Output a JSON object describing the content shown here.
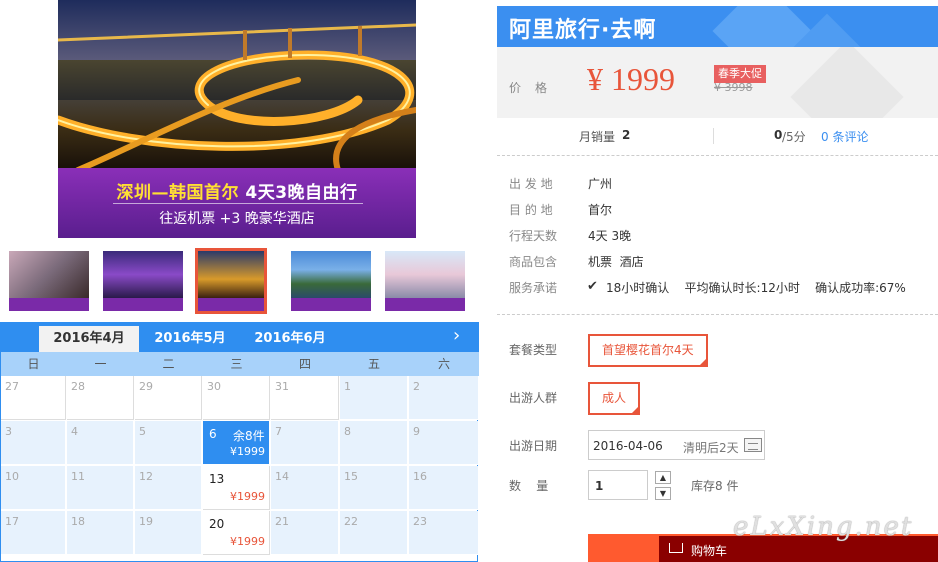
{
  "hero": {
    "title_a": "深圳—韩国首尔",
    "title_b": "4天3晚自由行",
    "subtitle": "往返机票 +3 晚豪华酒店"
  },
  "calendar": {
    "months": [
      "2016年4月",
      "2016年5月",
      "2016年6月"
    ],
    "active_month": 0,
    "next_icon": "chevron-right-icon",
    "weekdays": [
      "日",
      "一",
      "二",
      "三",
      "四",
      "五",
      "六"
    ],
    "rows": [
      [
        "27",
        "28",
        "29",
        "30",
        "31",
        "1",
        "2"
      ],
      [
        "3",
        "4",
        "5",
        "6",
        "7",
        "8",
        "9"
      ],
      [
        "10",
        "11",
        "12",
        "13",
        "14",
        "15",
        "16"
      ],
      [
        "17",
        "18",
        "19",
        "20",
        "21",
        "22",
        "23"
      ]
    ],
    "available": {
      "6": {
        "price": "¥1999",
        "stock": "余8件"
      },
      "13": {
        "price": "¥1999"
      },
      "20": {
        "price": "¥1999"
      }
    },
    "selected": "6"
  },
  "brand": {
    "title": "阿里旅行·去啊"
  },
  "price": {
    "label": "价格",
    "value": "¥ 1999",
    "promo": "春季大促",
    "original": "¥ 3998"
  },
  "sales": {
    "monthly_label": "月销量",
    "monthly_value": "2",
    "score": "0",
    "score_suffix": "/5分",
    "reviews": "0 条评论"
  },
  "details": [
    {
      "key": "出 发 地",
      "value": "广州"
    },
    {
      "key": "目 的 地",
      "value": "首尔"
    },
    {
      "key": "行程天数",
      "value": "4天 3晚"
    },
    {
      "key": "商品包含",
      "value": "机票  酒店"
    },
    {
      "key": "服务承诺",
      "value": "18小时确认    平均确认时长:12小时    确认成功率:67%"
    }
  ],
  "options": {
    "package_label": "套餐类型",
    "package_value": "首望樱花首尔4天",
    "crowd_label": "出游人群",
    "crowd_value": "成人",
    "date_label": "出游日期",
    "date_value": "2016-04-06",
    "date_hint": "清明后2天",
    "qty_label": "数    量",
    "qty_value": "1",
    "stock": "库存8 件"
  },
  "cart": {
    "label": "购物车"
  },
  "watermark": "eLxXing.net",
  "colors": {
    "accent": "#e8553a",
    "brand_blue": "#3b8ff0",
    "cal_blue": "#2f8ef0"
  }
}
